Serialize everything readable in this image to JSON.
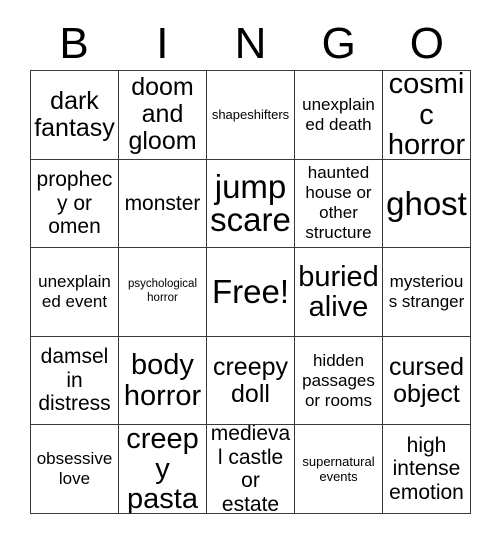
{
  "header": {
    "letters": [
      "B",
      "I",
      "N",
      "G",
      "O"
    ]
  },
  "colors": {
    "grid_border": "#3a3a3a",
    "text": "#000000",
    "background": "#ffffff"
  },
  "grid": {
    "rows": 5,
    "columns": 5,
    "cells": [
      {
        "text": "dark fantasy",
        "size": "lg",
        "free": false
      },
      {
        "text": "doom and gloom",
        "size": "lg",
        "free": false
      },
      {
        "text": "shapeshifters",
        "size": "xs",
        "free": false
      },
      {
        "text": "unexplained death",
        "size": "sm",
        "free": false
      },
      {
        "text": "cosmic horror",
        "size": "xl",
        "free": false
      },
      {
        "text": "prophecy or omen",
        "size": "md",
        "free": false
      },
      {
        "text": "monster",
        "size": "md",
        "free": false
      },
      {
        "text": "jump scare",
        "size": "xxl",
        "free": false
      },
      {
        "text": "haunted house or other structure",
        "size": "sm",
        "free": false
      },
      {
        "text": "ghost",
        "size": "xxl",
        "free": false
      },
      {
        "text": "unexplained event",
        "size": "sm",
        "free": false
      },
      {
        "text": "psychological horror",
        "size": "xxs",
        "free": false
      },
      {
        "text": "Free!",
        "size": "xxl",
        "free": true
      },
      {
        "text": "buried alive",
        "size": "xl",
        "free": false
      },
      {
        "text": "mysterious stranger",
        "size": "sm",
        "free": false
      },
      {
        "text": "damsel in distress",
        "size": "md",
        "free": false
      },
      {
        "text": "body horror",
        "size": "xl",
        "free": false
      },
      {
        "text": "creepy doll",
        "size": "lg",
        "free": false
      },
      {
        "text": "hidden passages or rooms",
        "size": "sm",
        "free": false
      },
      {
        "text": "cursed object",
        "size": "lg",
        "free": false
      },
      {
        "text": "obsessive love",
        "size": "sm",
        "free": false
      },
      {
        "text": "creepy pasta",
        "size": "xl",
        "free": false
      },
      {
        "text": "medieval castle or estate",
        "size": "md",
        "free": false
      },
      {
        "text": "supernatural events",
        "size": "xs",
        "free": false
      },
      {
        "text": "high intense emotion",
        "size": "md",
        "free": false
      }
    ]
  }
}
